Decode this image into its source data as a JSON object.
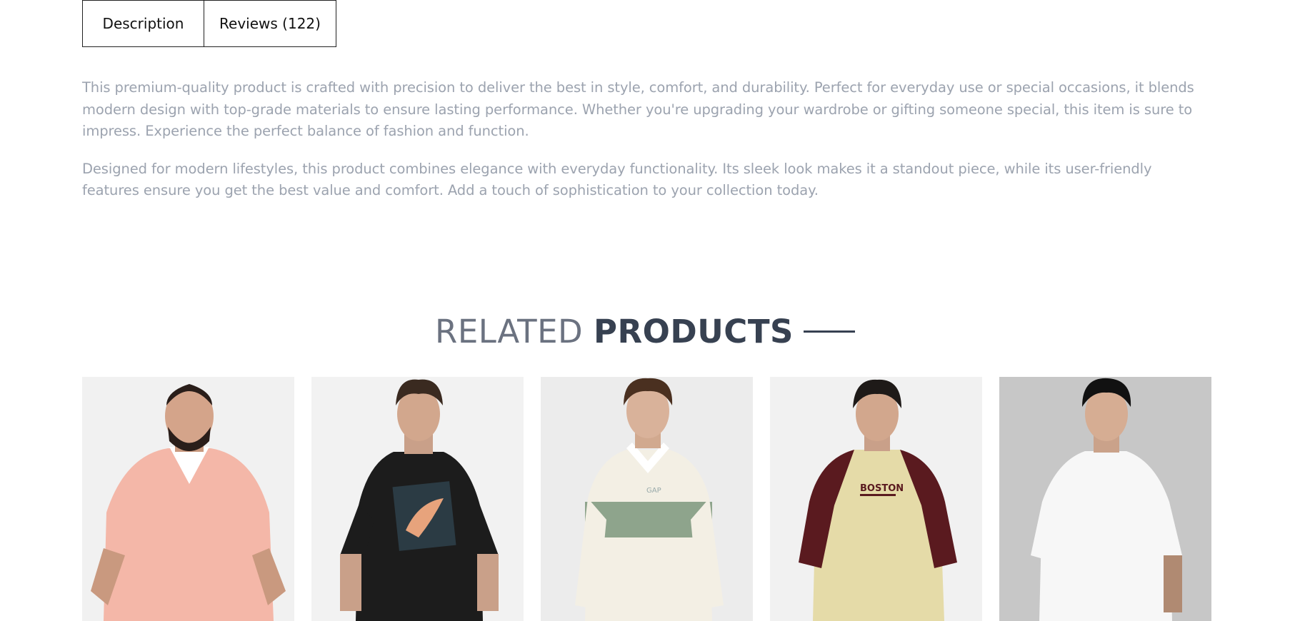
{
  "tabs": [
    {
      "label": "Description",
      "active": true
    },
    {
      "label": "Reviews (122)",
      "active": false
    }
  ],
  "description": {
    "paragraphs": [
      "This premium-quality product is crafted with precision to deliver the best in style, comfort, and durability. Perfect for everyday use or special occasions, it blends modern design with top-grade materials to ensure lasting performance. Whether you're upgrading your wardrobe or gifting someone special, this item is sure to impress. Experience the perfect balance of fashion and function.",
      "Designed for modern lifestyles, this product combines elegance with everyday functionality. Its sleek look makes it a standout piece, while its user-friendly features ensure you get the best value and comfort. Add a touch of sophistication to your collection today."
    ]
  },
  "related": {
    "title_light": "RELATED",
    "title_bold": "PRODUCTS"
  },
  "products": [
    {
      "image": "pink-polo-model",
      "bg": "#f1f1f1",
      "shirt": "#f4b7a8",
      "collar": "#ffffff"
    },
    {
      "image": "black-puma-tee-model",
      "bg": "#f2f2f2",
      "shirt": "#1c1c1c",
      "graphic": "#e7a37c"
    },
    {
      "image": "cream-green-stripe-polo-model",
      "bg": "#ececec",
      "shirt": "#f3efe4",
      "stripe": "#8ea48c"
    },
    {
      "image": "boston-raglan-tee-model",
      "bg": "#f1f1f1",
      "shirt": "#e5dba8",
      "sleeve": "#5a1a1f",
      "print": "BOSTON"
    },
    {
      "image": "white-tee-model",
      "bg": "#c7c7c7",
      "shirt": "#f7f7f7"
    }
  ]
}
